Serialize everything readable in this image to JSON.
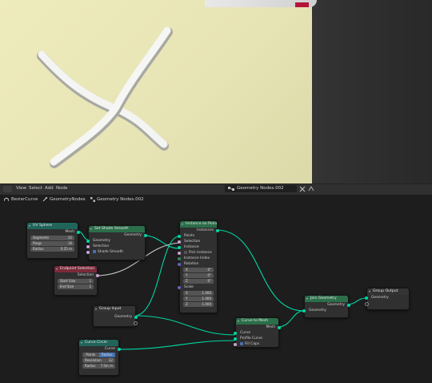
{
  "header": {
    "menu": [
      "View",
      "Select",
      "Add",
      "Node"
    ],
    "node_tree_name": "Geometry Nodes.002"
  },
  "breadcrumb": [
    "BezierCurve",
    "GeometryNodes",
    "Geometry Nodes.002"
  ],
  "nodes": {
    "uv_sphere": {
      "title": "UV Sphere",
      "output": "Mesh",
      "fields": [
        {
          "label": "Segments",
          "value": "32"
        },
        {
          "label": "Rings",
          "value": "16"
        },
        {
          "label": "Radius",
          "value": "0.25 m"
        }
      ]
    },
    "set_shade_smooth": {
      "title": "Set Shade Smooth",
      "output": "Geometry",
      "inputs": [
        "Geometry",
        "Selection",
        "Shade Smooth"
      ]
    },
    "endpoint_selection": {
      "title": "Endpoint Selection",
      "output": "Selection",
      "fields": [
        {
          "label": "Start Size",
          "value": "1"
        },
        {
          "label": "End Size",
          "value": "1"
        }
      ]
    },
    "instance_on_points": {
      "title": "Instance on Points",
      "output": "Instances",
      "inputs": [
        "Points",
        "Selection",
        "Instance",
        "Pick Instance",
        "Instance Index",
        "Rotation",
        "Scale"
      ],
      "rotation": [
        {
          "label": "X",
          "value": "0°"
        },
        {
          "label": "Y",
          "value": "0°"
        },
        {
          "label": "Z",
          "value": "0°"
        }
      ],
      "scale": [
        {
          "label": "X",
          "value": "1.000"
        },
        {
          "label": "Y",
          "value": "1.000"
        },
        {
          "label": "Z",
          "value": "1.000"
        }
      ]
    },
    "group_input": {
      "title": "Group Input",
      "output": "Geometry"
    },
    "curve_to_mesh": {
      "title": "Curve to Mesh",
      "output": "Mesh",
      "inputs": [
        "Curve",
        "Profile Curve",
        "Fill Caps"
      ]
    },
    "curve_circle": {
      "title": "Curve Circle",
      "output": "Curve",
      "modes": [
        "Points",
        "Radius"
      ],
      "active_mode": "Radius",
      "fields": [
        {
          "label": "Resolution",
          "value": "32"
        },
        {
          "label": "Radius",
          "value": "7.5m m"
        }
      ]
    },
    "join_geometry": {
      "title": "Join Geometry",
      "output": "Geometry",
      "input": "Geometry"
    },
    "group_output": {
      "title": "Group Output",
      "input": "Geometry"
    }
  },
  "colors": {
    "header_teal": "#20645a",
    "header_red": "#7a2a3a",
    "link_geometry": "#00d6a3",
    "link_other": "#c8c8c8",
    "accent": "#4772b3"
  }
}
